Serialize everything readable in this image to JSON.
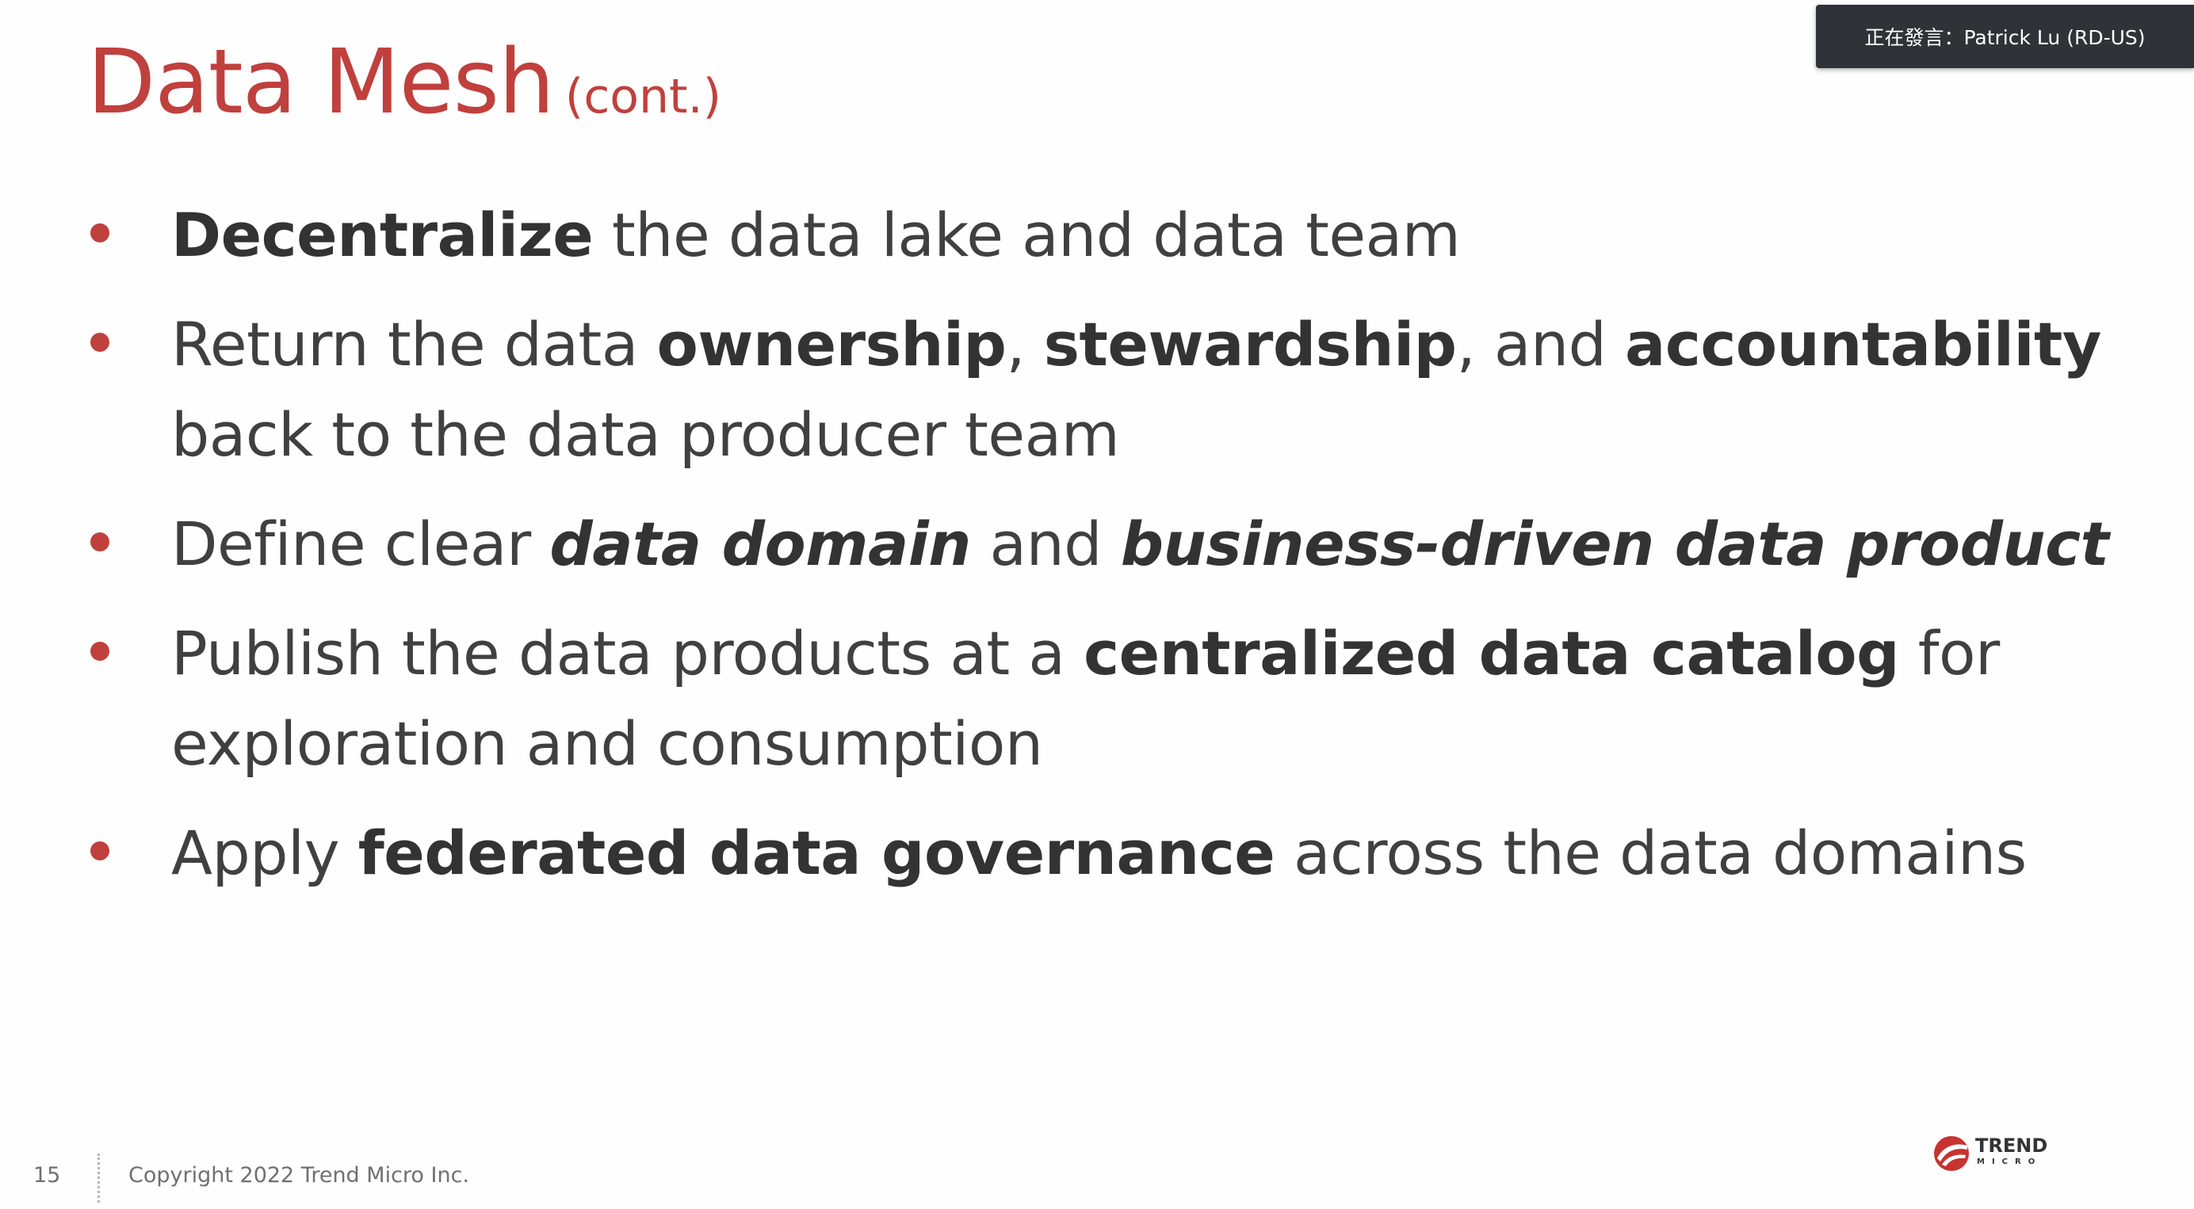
{
  "slide": {
    "title_main": "Data Mesh",
    "title_sub": "(cont.)",
    "bullets": [
      {
        "parts": [
          {
            "text": "Decentralize",
            "bold": true
          },
          {
            "text": " the data lake and data team"
          }
        ]
      },
      {
        "parts": [
          {
            "text": "Return the data "
          },
          {
            "text": "ownership",
            "bold": true
          },
          {
            "text": ", "
          },
          {
            "text": "stewardship",
            "bold": true
          },
          {
            "text": ", and "
          },
          {
            "text": "accountability",
            "bold": true
          },
          {
            "text": " back to the data producer team"
          }
        ]
      },
      {
        "parts": [
          {
            "text": "Define clear "
          },
          {
            "text": "data domain",
            "bold": true,
            "italic": true
          },
          {
            "text": " and "
          },
          {
            "text": "business-driven data product",
            "bold": true,
            "italic": true
          }
        ]
      },
      {
        "parts": [
          {
            "text": "Publish the data products at a "
          },
          {
            "text": "centralized data catalog",
            "bold": true
          },
          {
            "text": " for exploration and consumption"
          }
        ]
      },
      {
        "parts": [
          {
            "text": "Apply "
          },
          {
            "text": "federated data governance",
            "bold": true
          },
          {
            "text": " across the data domains"
          }
        ]
      }
    ],
    "page_number": "15",
    "copyright": "Copyright 2022 Trend Micro Inc.",
    "logo_word": "TREND",
    "logo_sub": "MICRO"
  },
  "overlay": {
    "speaker_label": "正在發言：Patrick Lu (RD-US)"
  },
  "colors": {
    "accent": "#c0403d",
    "body_text": "#404040",
    "overlay_bg": "#2f3337"
  },
  "icons": {
    "logo": "trend-micro-logo-icon",
    "bullet": "bullet-dot-icon"
  }
}
